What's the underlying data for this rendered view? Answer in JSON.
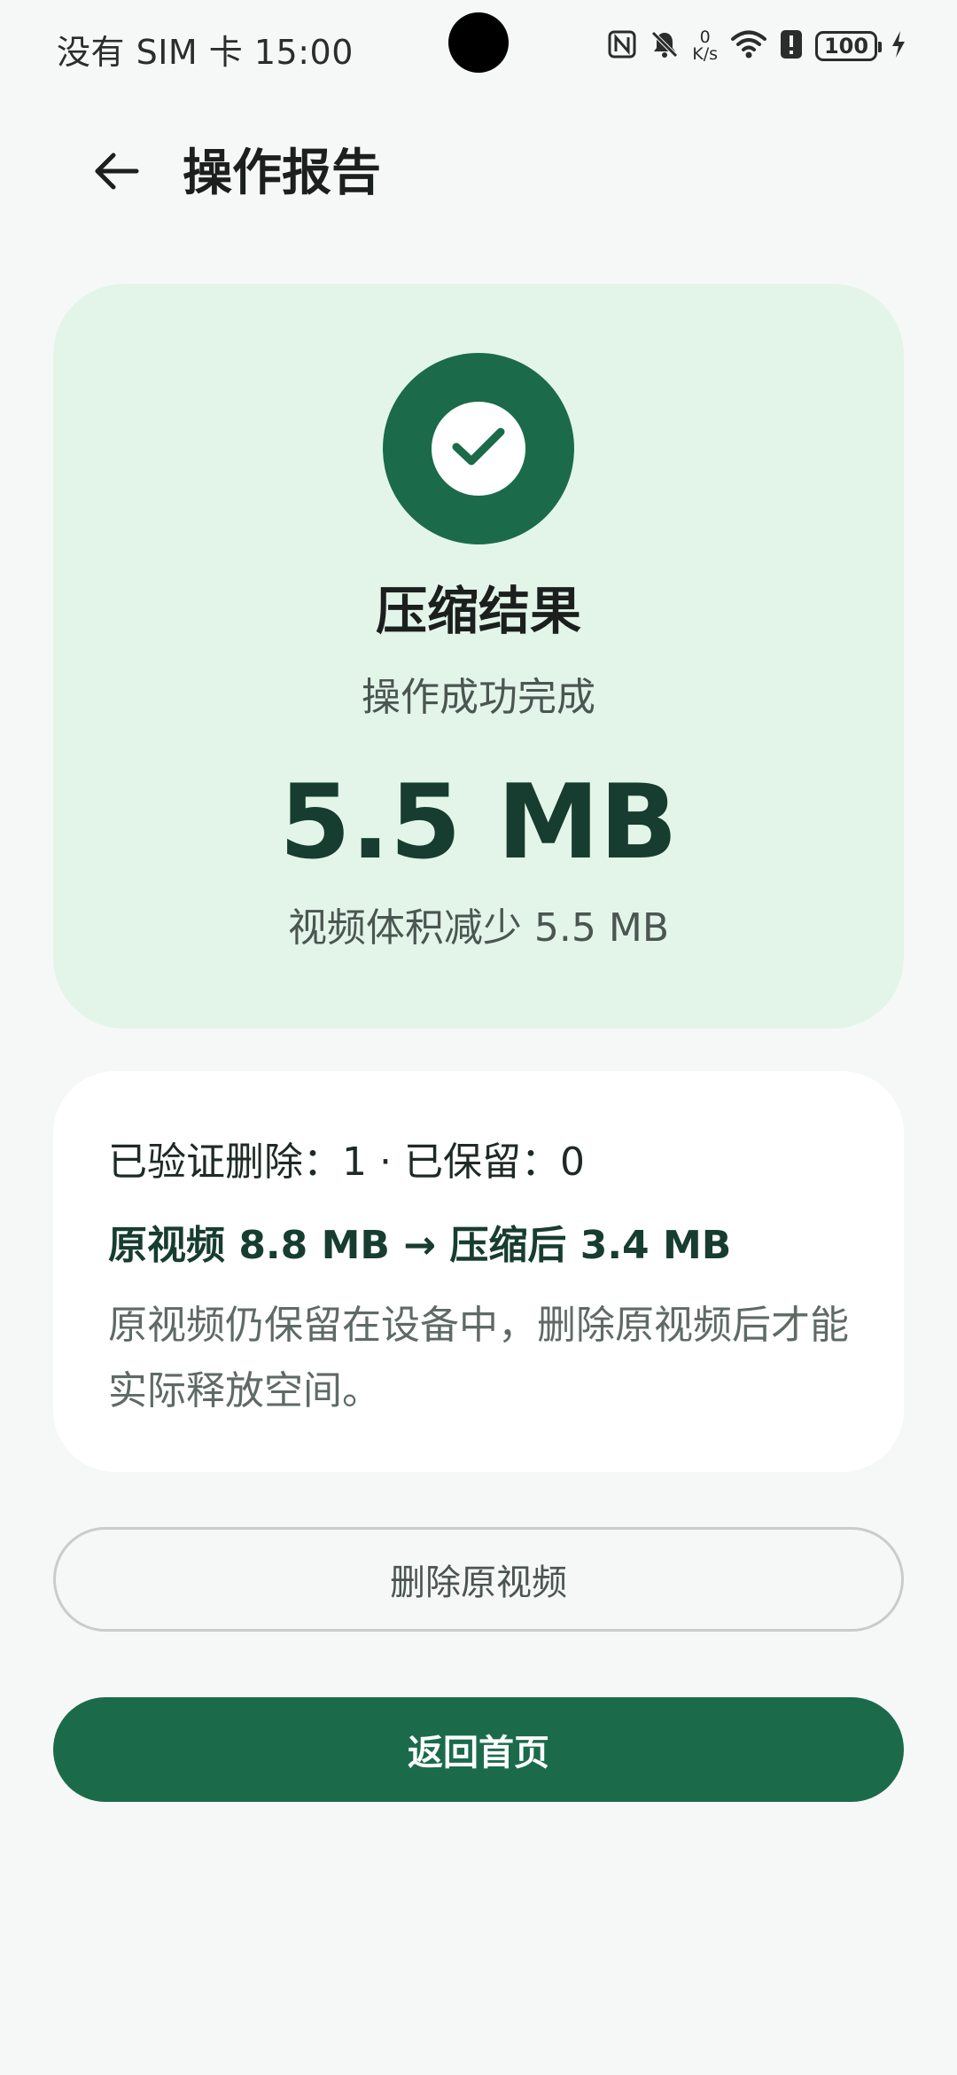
{
  "status_bar": {
    "carrier": "没有 SIM 卡",
    "time": "15:00",
    "net_speed_value": "0",
    "net_speed_unit": "K/s",
    "battery": "100",
    "icons": [
      "nfc-icon",
      "silent-bell-icon",
      "wifi-icon",
      "alert-icon",
      "battery-icon",
      "charging-icon"
    ]
  },
  "header": {
    "title": "操作报告",
    "back_icon": "arrow-left-icon"
  },
  "result": {
    "icon": "check-icon",
    "title": "压缩结果",
    "subtitle": "操作成功完成",
    "amount": "5.5 MB",
    "description": "视频体积减少 5.5 MB"
  },
  "info": {
    "line1": "已验证删除：1 · 已保留：0",
    "line2": "原视频 8.8 MB → 压缩后 3.4 MB",
    "line3": "原视频仍保留在设备中，删除原视频后才能实际释放空间。"
  },
  "actions": {
    "delete_original": "删除原视频",
    "go_home": "返回首页"
  },
  "colors": {
    "accent": "#1b6b4b",
    "card_bg": "#e3f5e9",
    "background": "#f6f8f7"
  }
}
